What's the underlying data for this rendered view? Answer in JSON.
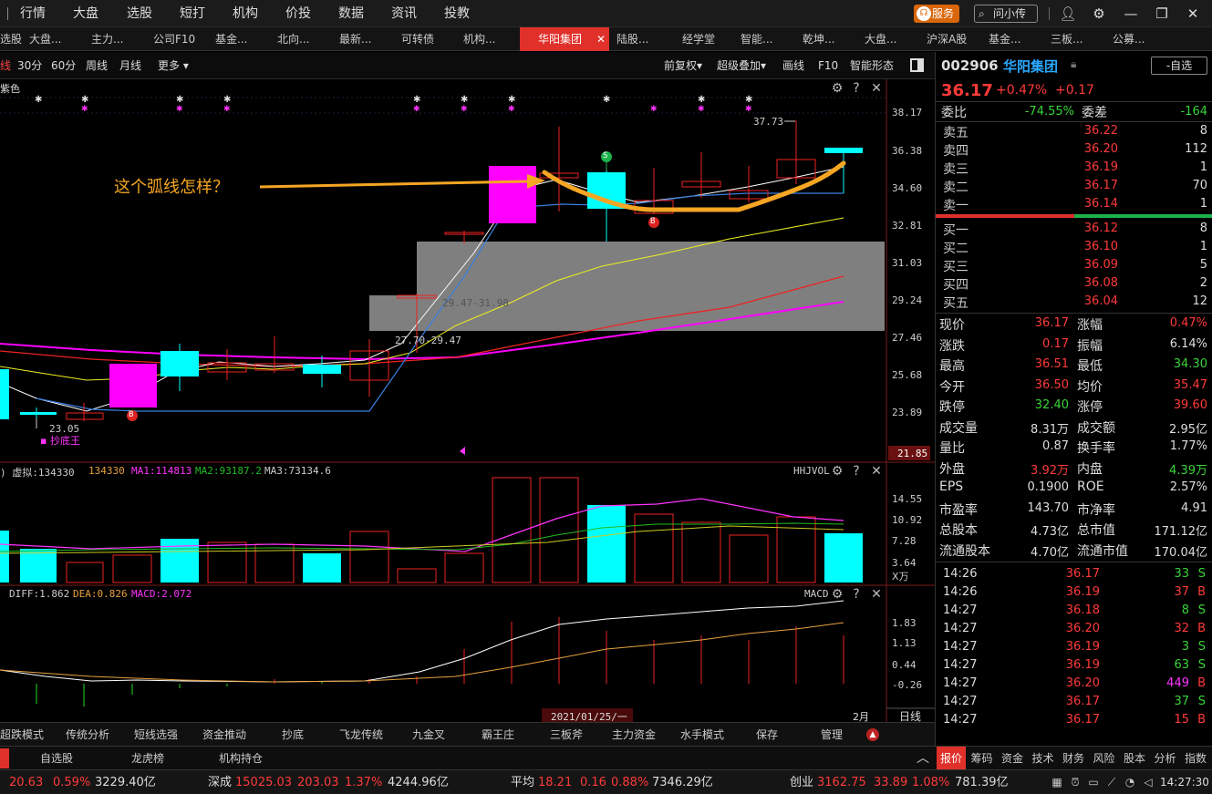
{
  "menu": {
    "items": [
      "行情",
      "大盘",
      "选股",
      "短打",
      "机构",
      "价投",
      "数据",
      "资讯",
      "投教"
    ],
    "service_label": "服务",
    "ask_label": "问小传"
  },
  "tabs": [
    "选股",
    "大盘...",
    "主力...",
    "公司F10",
    "基金...",
    "北向...",
    "最新...",
    "可转债",
    "机构...",
    "华阳集团",
    "陆股...",
    "经学堂",
    "智能...",
    "乾坤...",
    "大盘...",
    "沪深A股",
    "基金...",
    "三板...",
    "公募..."
  ],
  "toolbar": {
    "periods": [
      "线",
      "30分",
      "60分",
      "周线",
      "月线",
      "更多"
    ],
    "right_items": [
      "前复权",
      "超级叠加",
      "画线",
      "F10",
      "智能形态"
    ]
  },
  "price_panel": {
    "indicator_label": "紫色",
    "annotation": "这个弧线怎样？",
    "y_ticks": [
      "38.17",
      "36.38",
      "34.60",
      "32.81",
      "31.03",
      "29.24",
      "27.46",
      "25.68",
      "23.89"
    ],
    "last_price_tag": "21.85",
    "high_marker": "37.73",
    "low_marker": "23.05",
    "zone_labels": [
      "29.47-31.98",
      "27.70-29.47"
    ],
    "bottom_king": "抄底王",
    "signal_b": "B",
    "signal_s": "S"
  },
  "volume_panel": {
    "label_vol": "虚拟:134330",
    "label_val": "134330",
    "label_ma1": "MA1:114813",
    "label_ma2": "MA2:93187.2",
    "label_ma3": "MA3:73134.6",
    "name": "HHJVOL",
    "y_ticks": [
      "14.55",
      "10.92",
      "7.28",
      "3.64"
    ],
    "unit": "X万"
  },
  "macd_panel": {
    "diff": "DIFF:1.862",
    "dea": "DEA:0.826",
    "macd": "MACD:2.072",
    "name": "MACD",
    "y_ticks": [
      "1.83",
      "1.13",
      "0.44",
      "-0.26"
    ],
    "date_label": "2021/01/25/一",
    "month_label": "2月",
    "period_label": "日线"
  },
  "strategy_bar": [
    "超跌模式",
    "传统分析",
    "短线选强",
    "资金推动",
    "抄底",
    "飞龙传统",
    "九金叉",
    "霸王庄",
    "三板斧",
    "主力资金",
    "水手模式",
    "保存",
    "管理"
  ],
  "sub_bar": [
    "自选股",
    "龙虎榜",
    "机构持仓"
  ],
  "stock": {
    "code": "002906",
    "name": "华阳集团",
    "watch_label": "-自选",
    "price": "36.17",
    "change_pct": "+0.47%",
    "change": "+0.17",
    "weibi_label": "委比",
    "weibi": "-74.55%",
    "weicha_label": "委差",
    "weicha": "-164"
  },
  "asks": [
    {
      "label": "卖五",
      "price": "36.22",
      "vol": "8"
    },
    {
      "label": "卖四",
      "price": "36.20",
      "vol": "112"
    },
    {
      "label": "卖三",
      "price": "36.19",
      "vol": "1"
    },
    {
      "label": "卖二",
      "price": "36.17",
      "vol": "70"
    },
    {
      "label": "卖一",
      "price": "36.14",
      "vol": "1"
    }
  ],
  "bids": [
    {
      "label": "买一",
      "price": "36.12",
      "vol": "8"
    },
    {
      "label": "买二",
      "price": "36.10",
      "vol": "1"
    },
    {
      "label": "买三",
      "price": "36.09",
      "vol": "5"
    },
    {
      "label": "买四",
      "price": "36.08",
      "vol": "2"
    },
    {
      "label": "买五",
      "price": "36.04",
      "vol": "12"
    }
  ],
  "stats": [
    [
      {
        "l": "现价",
        "v": "36.17",
        "c": "red"
      },
      {
        "l": "涨幅",
        "v": "0.47%",
        "c": "red"
      }
    ],
    [
      {
        "l": "涨跌",
        "v": "0.17",
        "c": "red"
      },
      {
        "l": "振幅",
        "v": "6.14%",
        "c": "white"
      }
    ],
    [
      {
        "l": "最高",
        "v": "36.51",
        "c": "red"
      },
      {
        "l": "最低",
        "v": "34.30",
        "c": "green"
      }
    ],
    [
      {
        "l": "今开",
        "v": "36.50",
        "c": "red"
      },
      {
        "l": "均价",
        "v": "35.47",
        "c": "red"
      }
    ],
    [
      {
        "l": "跌停",
        "v": "32.40",
        "c": "green"
      },
      {
        "l": "涨停",
        "v": "39.60",
        "c": "red"
      }
    ],
    [
      {
        "l": "成交量",
        "v": "8.31万",
        "c": "white"
      },
      {
        "l": "成交额",
        "v": "2.95亿",
        "c": "white"
      }
    ],
    [
      {
        "l": "量比",
        "v": "0.87",
        "c": "white"
      },
      {
        "l": "换手率",
        "v": "1.77%",
        "c": "white"
      }
    ],
    [
      {
        "l": "外盘",
        "v": "3.92万",
        "c": "red"
      },
      {
        "l": "内盘",
        "v": "4.39万",
        "c": "green"
      }
    ],
    [
      {
        "l": "EPS",
        "v": "0.1900",
        "c": "white"
      },
      {
        "l": "ROE",
        "v": "2.57%",
        "c": "white"
      }
    ],
    [
      {
        "l": "市盈率",
        "v": "143.70",
        "c": "white"
      },
      {
        "l": "市净率",
        "v": "4.91",
        "c": "white"
      }
    ],
    [
      {
        "l": "总股本",
        "v": "4.73亿",
        "c": "white"
      },
      {
        "l": "总市值",
        "v": "171.12亿",
        "c": "white"
      }
    ],
    [
      {
        "l": "流通股本",
        "v": "4.70亿",
        "c": "white"
      },
      {
        "l": "流通市值",
        "v": "170.04亿",
        "c": "white"
      }
    ]
  ],
  "ticks": [
    {
      "t": "14:26",
      "p": "36.17",
      "v": "33",
      "s": "S",
      "c": "green"
    },
    {
      "t": "14:26",
      "p": "36.19",
      "v": "37",
      "s": "B",
      "c": "red"
    },
    {
      "t": "14:27",
      "p": "36.18",
      "v": "8",
      "s": "S",
      "c": "green"
    },
    {
      "t": "14:27",
      "p": "36.20",
      "v": "32",
      "s": "B",
      "c": "red"
    },
    {
      "t": "14:27",
      "p": "36.19",
      "v": "3",
      "s": "S",
      "c": "green"
    },
    {
      "t": "14:27",
      "p": "36.19",
      "v": "63",
      "s": "S",
      "c": "green"
    },
    {
      "t": "14:27",
      "p": "36.20",
      "v": "449",
      "s": "B",
      "c": "magenta"
    },
    {
      "t": "14:27",
      "p": "36.17",
      "v": "37",
      "s": "S",
      "c": "green"
    },
    {
      "t": "14:27",
      "p": "36.17",
      "v": "15",
      "s": "B",
      "c": "red"
    }
  ],
  "right_tabs": [
    "报价",
    "筹码",
    "资金",
    "技术",
    "财务",
    "风险",
    "股本",
    "分析",
    "指数"
  ],
  "status": {
    "sh": {
      "v1": "20.63",
      "v2": "0.59%",
      "v3": "3229.40亿"
    },
    "sz": {
      "name": "深成",
      "v0": "15025.03",
      "v1": "203.03",
      "v2": "1.37%",
      "v3": "4244.96亿"
    },
    "avg": {
      "name": "平均",
      "v0": "18.21",
      "v1": "0.16",
      "v2": "0.88%",
      "v3": "7346.29亿"
    },
    "cy": {
      "name": "创业",
      "v0": "3162.75",
      "v1": "33.89",
      "v2": "1.08%",
      "v3": "781.39亿"
    },
    "time": "14:27:30"
  },
  "colors": {
    "up": "#ff3a3a",
    "down": "#3ad33a",
    "accent": "#e0302a",
    "cyan": "#00f0f0",
    "magenta": "#ff00ff",
    "annotation": "#f5a623"
  }
}
